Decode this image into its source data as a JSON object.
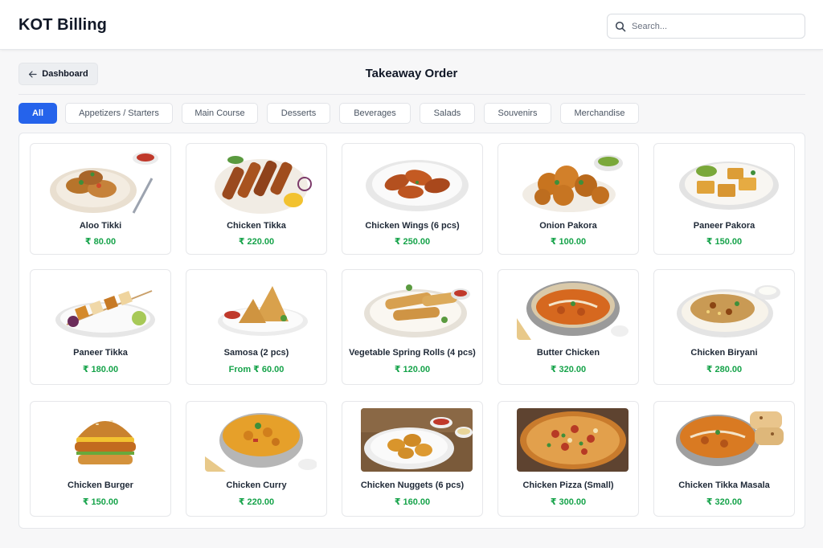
{
  "header": {
    "app_title": "KOT Billing",
    "search_placeholder": "Search..."
  },
  "toolbar": {
    "back_label": "Dashboard",
    "page_title": "Takeaway Order"
  },
  "tabs": [
    {
      "label": "All",
      "active": true
    },
    {
      "label": "Appetizers / Starters",
      "active": false
    },
    {
      "label": "Main Course",
      "active": false
    },
    {
      "label": "Desserts",
      "active": false
    },
    {
      "label": "Beverages",
      "active": false
    },
    {
      "label": "Salads",
      "active": false
    },
    {
      "label": "Souvenirs",
      "active": false
    },
    {
      "label": "Merchandise",
      "active": false
    }
  ],
  "items": [
    {
      "name": "Aloo Tikki",
      "price": "₹ 80.00",
      "image": "aloo-tikki-plate"
    },
    {
      "name": "Chicken Tikka",
      "price": "₹ 220.00",
      "image": "chicken-tikka-skewers"
    },
    {
      "name": "Chicken Wings (6 pcs)",
      "price": "₹ 250.00",
      "image": "chicken-wings-plate"
    },
    {
      "name": "Onion Pakora",
      "price": "₹ 100.00",
      "image": "onion-pakora-plate"
    },
    {
      "name": "Paneer Pakora",
      "price": "₹ 150.00",
      "image": "paneer-pakora-plate"
    },
    {
      "name": "Paneer Tikka",
      "price": "₹ 180.00",
      "image": "paneer-tikka-skewers"
    },
    {
      "name": "Samosa (2 pcs)",
      "price": "From ₹ 60.00",
      "image": "samosa-plate"
    },
    {
      "name": "Vegetable Spring Rolls (4 pcs)",
      "price": "₹ 120.00",
      "image": "spring-rolls-plate"
    },
    {
      "name": "Butter Chicken",
      "price": "₹ 320.00",
      "image": "butter-chicken-bowl"
    },
    {
      "name": "Chicken Biryani",
      "price": "₹ 280.00",
      "image": "chicken-biryani-plate"
    },
    {
      "name": "Chicken Burger",
      "price": "₹ 150.00",
      "image": "chicken-burger"
    },
    {
      "name": "Chicken Curry",
      "price": "₹ 220.00",
      "image": "chicken-curry-bowl"
    },
    {
      "name": "Chicken Nuggets (6 pcs)",
      "price": "₹ 160.00",
      "image": "chicken-nuggets-plate"
    },
    {
      "name": "Chicken Pizza (Small)",
      "price": "₹ 300.00",
      "image": "chicken-pizza"
    },
    {
      "name": "Chicken Tikka Masala",
      "price": "₹ 320.00",
      "image": "chicken-tikka-masala-bowl"
    }
  ],
  "colors": {
    "accent": "#2563eb",
    "price": "#16a34a"
  }
}
